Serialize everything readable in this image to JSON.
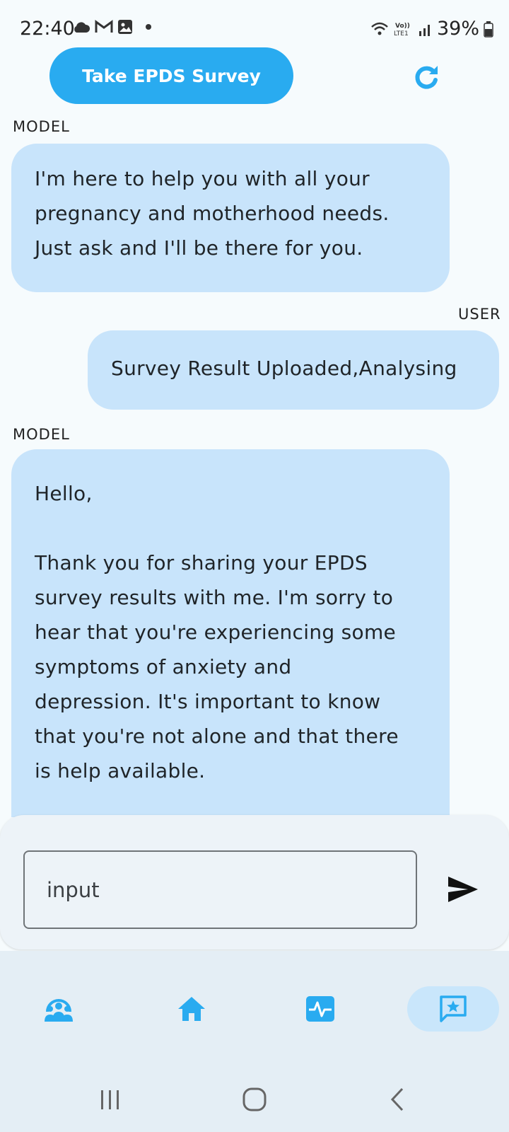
{
  "status_bar": {
    "time": "22:40",
    "battery": "39%",
    "icons": [
      "cloud-icon",
      "gmail-icon",
      "image-icon",
      "dot-icon",
      "wifi-icon",
      "volte-icon",
      "signal-icon",
      "battery-icon"
    ]
  },
  "header": {
    "survey_button_label": "Take EPDS Survey",
    "refresh_icon": "refresh-icon"
  },
  "chat": {
    "messages": [
      {
        "role": "MODEL",
        "lines": [
          "I'm here to help you with all your",
          "pregnancy and motherhood needs.",
          "Just ask and I'll be there for you."
        ]
      },
      {
        "role": "USER",
        "text": "Survey Result Uploaded,Analysing"
      },
      {
        "role": "MODEL",
        "greeting": "Hello,",
        "lines": [
          "Thank you for sharing your EPDS",
          "survey results with me. I'm sorry to",
          "hear that you're experiencing some",
          "symptoms of anxiety and",
          "depression. It's important to know",
          "that you're not alone and that there",
          "is help available."
        ]
      }
    ]
  },
  "composer": {
    "placeholder": "input",
    "send_icon": "send-icon"
  },
  "colors": {
    "accent": "#29abf0",
    "bubble": "#c8e4fb",
    "background": "#f6fbfd",
    "nav_background": "#e4eef5"
  },
  "bottom_nav": {
    "items": [
      {
        "icon": "community-icon",
        "active": false
      },
      {
        "icon": "home-icon",
        "active": false
      },
      {
        "icon": "health-icon",
        "active": false
      },
      {
        "icon": "chat-star-icon",
        "active": true
      }
    ]
  },
  "system_nav": [
    "recents-icon",
    "home-circle-icon",
    "back-icon"
  ]
}
